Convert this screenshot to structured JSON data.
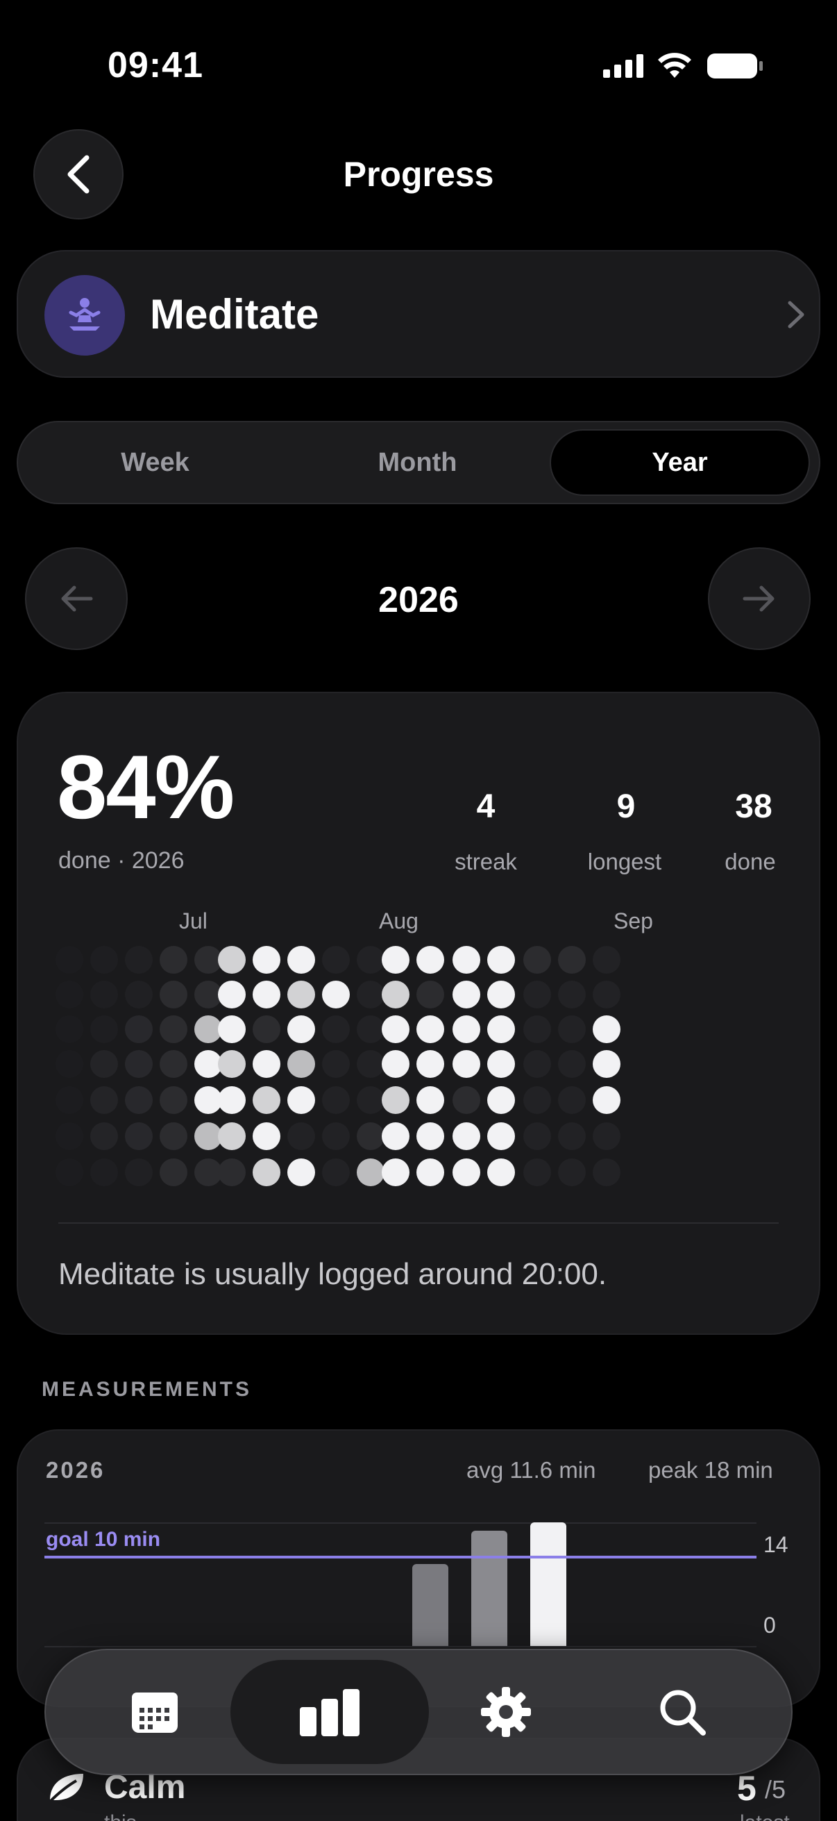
{
  "status": {
    "time": "09:41"
  },
  "header": {
    "title": "Progress"
  },
  "habit": {
    "name": "Meditate"
  },
  "segments": [
    "Week",
    "Month",
    "Year"
  ],
  "segment_selected": "Year",
  "period": {
    "label": "2026"
  },
  "summary": {
    "percent": "84%",
    "subtitle": "done · 2026",
    "stats": [
      {
        "value": "4",
        "label": "streak"
      },
      {
        "value": "9",
        "label": "longest"
      },
      {
        "value": "38",
        "label": "done"
      }
    ],
    "months": [
      "Jul",
      "Aug",
      "Sep"
    ],
    "insight": "Meditate is usually logged around 20:00."
  },
  "measurements": {
    "section_title": "MEASUREMENTS",
    "year": "2026",
    "avg": "avg 11.6 min",
    "peak": "peak 18 min",
    "goal": "goal 10 min",
    "axis": [
      "14",
      "0"
    ]
  },
  "next_habit": {
    "name": "Calm",
    "subtitle": "this",
    "value": "5",
    "of": "/5",
    "note": "latest"
  },
  "colors": {
    "accent": "#8b7fe8",
    "avatar_bg": "#3b3475"
  },
  "tabs": [
    "calendar-icon",
    "stats-icon",
    "settings-icon",
    "search-icon"
  ]
}
